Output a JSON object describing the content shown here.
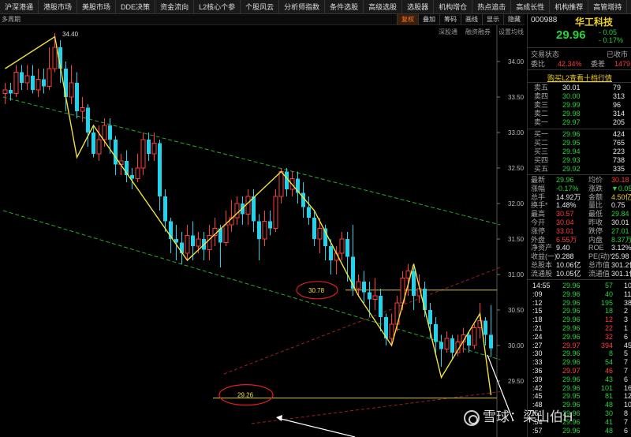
{
  "menu": [
    "沪深港通",
    "港股市场",
    "美股市场",
    "DDE决策",
    "资金流向",
    "L2核心个参",
    "个股风云",
    "分析师指数",
    "条件选股",
    "高级选股",
    "选股器",
    "机构增仓",
    "热点追击",
    "高成长性",
    "机构推荐",
    "高管增持"
  ],
  "toolbar": {
    "period_label": "多周期",
    "buttons": [
      "复权",
      "叠加",
      "筹码",
      "画线",
      "显示",
      "隐藏"
    ],
    "active_button": "复权"
  },
  "sublinks": [
    "深股通",
    "融资融券",
    "设置均线"
  ],
  "stock": {
    "code": "000988",
    "name": "华工科技",
    "price": "29.96",
    "change": "- 0.05",
    "change_pct": "- 0.17%"
  },
  "status": {
    "label": "交易状态",
    "value": "已收市",
    "wb_label": "委比",
    "wb_value": "42.34%",
    "wc_label": "委差",
    "wc_value": "1479"
  },
  "l2_link": "购买L2查看十档行情",
  "asks": [
    {
      "label": "卖五",
      "price": "30.01",
      "vol": "79"
    },
    {
      "label": "卖四",
      "price": "30.00",
      "vol": "313"
    },
    {
      "label": "卖三",
      "price": "29.99",
      "vol": "96"
    },
    {
      "label": "卖二",
      "price": "29.98",
      "vol": "314"
    },
    {
      "label": "卖一",
      "price": "29.97",
      "vol": "205"
    }
  ],
  "bids": [
    {
      "label": "买一",
      "price": "29.96",
      "vol": "424"
    },
    {
      "label": "买二",
      "price": "29.95",
      "vol": "765"
    },
    {
      "label": "买三",
      "price": "29.94",
      "vol": "223"
    },
    {
      "label": "买四",
      "price": "29.93",
      "vol": "738"
    },
    {
      "label": "买五",
      "price": "29.92",
      "vol": "335"
    }
  ],
  "stats": [
    {
      "l1": "最新",
      "v1": "29.96",
      "c1": "grn",
      "l2": "均价",
      "v2": "30.18",
      "c2": "red"
    },
    {
      "l1": "涨幅",
      "v1": "-0.17%",
      "c1": "grn",
      "l2": "涨跌",
      "v2": "▼0.05",
      "c2": "grn"
    },
    {
      "l1": "总手",
      "v1": "14.92万",
      "c1": "wht",
      "l2": "金额",
      "v2": "4.50亿",
      "c2": "yel"
    },
    {
      "l1": "换手*",
      "v1": "1.48%",
      "c1": "wht",
      "l2": "量比",
      "v2": "0.75",
      "c2": "wht"
    },
    {
      "l1": "最高",
      "v1": "30.57",
      "c1": "red",
      "l2": "最低",
      "v2": "29.84",
      "c2": "grn"
    },
    {
      "l1": "今开",
      "v1": "30.04",
      "c1": "red",
      "l2": "昨收",
      "v2": "30.01",
      "c2": "wht"
    },
    {
      "l1": "涨停",
      "v1": "33.01",
      "c1": "red",
      "l2": "跌停",
      "v2": "27.01",
      "c2": "grn"
    },
    {
      "l1": "外盘",
      "v1": "6.55万",
      "c1": "red",
      "l2": "内盘",
      "v2": "8.37万",
      "c2": "grn"
    },
    {
      "l1": "净资产",
      "v1": "9.40",
      "c1": "wht",
      "l2": "ROE",
      "v2": "3.12%",
      "c2": "wht"
    },
    {
      "l1": "收益(一)",
      "v1": "0.288",
      "c1": "wht",
      "l2": "PE(动)*",
      "v2": "25.98",
      "c2": "wht"
    },
    {
      "l1": "总股本",
      "v1": "10.06亿",
      "c1": "wht",
      "l2": "总市值",
      "v2": "301.2亿",
      "c2": "wht"
    },
    {
      "l1": "流通股",
      "v1": "10.05亿",
      "c1": "wht",
      "l2": "流通值",
      "v2": "301.1亿",
      "c2": "wht"
    }
  ],
  "ticks": [
    {
      "t": "14:55",
      "p": "29.96",
      "pc": "grn",
      "v": "57",
      "vc": "grn",
      "x": "10"
    },
    {
      "t": ":09",
      "p": "29.96",
      "pc": "grn",
      "v": "40",
      "vc": "grn",
      "x": "11"
    },
    {
      "t": ":12",
      "p": "29.96",
      "pc": "grn",
      "v": "195",
      "vc": "grn",
      "x": "38"
    },
    {
      "t": ":15",
      "p": "29.96",
      "pc": "grn",
      "v": "18",
      "vc": "grn",
      "x": "2"
    },
    {
      "t": ":18",
      "p": "29.96",
      "pc": "grn",
      "v": "12",
      "vc": "red",
      "x": "3"
    },
    {
      "t": ":21",
      "p": "29.96",
      "pc": "grn",
      "v": "22",
      "vc": "red",
      "x": "1"
    },
    {
      "t": ":24",
      "p": "29.96",
      "pc": "grn",
      "v": "32",
      "vc": "red",
      "x": "6"
    },
    {
      "t": ":27",
      "p": "29.97",
      "pc": "red",
      "v": "394",
      "vc": "red",
      "x": "45"
    },
    {
      "t": ":30",
      "p": "29.96",
      "pc": "grn",
      "v": "8",
      "vc": "grn",
      "x": "5"
    },
    {
      "t": ":33",
      "p": "29.96",
      "pc": "grn",
      "v": "54",
      "vc": "grn",
      "x": "7"
    },
    {
      "t": ":36",
      "p": "29.97",
      "pc": "red",
      "v": "46",
      "vc": "red",
      "x": "7"
    },
    {
      "t": ":39",
      "p": "29.96",
      "pc": "grn",
      "v": "43",
      "vc": "grn",
      "x": "6"
    },
    {
      "t": ":42",
      "p": "29.96",
      "pc": "grn",
      "v": "101",
      "vc": "grn",
      "x": "16"
    },
    {
      "t": ":45",
      "p": "29.95",
      "pc": "grn",
      "v": "81",
      "vc": "grn",
      "x": "12"
    },
    {
      "t": ":48",
      "p": "29.96",
      "pc": "grn",
      "v": "48",
      "vc": "grn",
      "x": "10"
    },
    {
      "t": ":51",
      "p": "29.96",
      "pc": "grn",
      "v": "30",
      "vc": "grn",
      "x": "8"
    },
    {
      "t": ":54",
      "p": "29.96",
      "pc": "grn",
      "v": "41",
      "vc": "grn",
      "x": "7"
    },
    {
      "t": ":57",
      "p": "29.96",
      "pc": "grn",
      "v": "48",
      "vc": "grn",
      "x": "6"
    }
  ],
  "watermark": "雪球：梁山伯H",
  "chart_data": {
    "type": "candlestick",
    "title": "",
    "xlabel": "",
    "ylabel": "",
    "ylim": [
      29.4,
      34.4
    ],
    "yticks": [
      "34.00",
      "33.50",
      "33.00",
      "32.50",
      "32.00",
      "31.50",
      "31.00",
      "30.50",
      "30.00",
      "29.50"
    ],
    "high_label": "34.40",
    "annotations": [
      "30.78",
      "29.26"
    ],
    "colors": {
      "up": "#ff3b3b",
      "down": "#21d4ee",
      "zigzag": "#f0e040",
      "channel": "#2ea82e",
      "trend": "#a02020"
    },
    "candles": [
      [
        33.55,
        33.6,
        33.4,
        33.7
      ],
      [
        33.6,
        33.55,
        33.45,
        33.7
      ],
      [
        33.55,
        33.85,
        33.5,
        33.95
      ],
      [
        33.85,
        33.7,
        33.6,
        33.95
      ],
      [
        33.7,
        33.8,
        33.6,
        33.95
      ],
      [
        33.8,
        33.6,
        33.55,
        33.95
      ],
      [
        33.6,
        33.75,
        33.5,
        33.9
      ],
      [
        33.75,
        33.65,
        33.55,
        33.9
      ],
      [
        33.65,
        33.9,
        33.6,
        34.2
      ],
      [
        33.9,
        34.2,
        33.85,
        34.4
      ],
      [
        34.2,
        33.9,
        33.7,
        34.3
      ],
      [
        33.9,
        33.5,
        33.3,
        34.0
      ],
      [
        33.5,
        33.7,
        33.4,
        33.95
      ],
      [
        33.7,
        33.3,
        33.2,
        33.85
      ],
      [
        33.3,
        33.35,
        33.15,
        33.5
      ],
      [
        33.35,
        33.0,
        32.8,
        33.4
      ],
      [
        33.0,
        32.7,
        32.65,
        33.1
      ],
      [
        32.7,
        32.9,
        32.6,
        33.1
      ],
      [
        32.9,
        33.1,
        32.8,
        33.2
      ],
      [
        33.1,
        32.9,
        32.7,
        33.2
      ],
      [
        32.9,
        32.55,
        32.4,
        32.95
      ],
      [
        32.55,
        32.6,
        32.4,
        32.7
      ],
      [
        32.6,
        32.4,
        32.3,
        32.75
      ],
      [
        32.4,
        32.35,
        32.2,
        32.5
      ],
      [
        32.35,
        32.5,
        32.3,
        32.7
      ],
      [
        32.5,
        32.9,
        32.4,
        33.0
      ],
      [
        32.9,
        32.7,
        32.6,
        33.0
      ],
      [
        32.7,
        32.85,
        32.6,
        33.0
      ],
      [
        32.85,
        32.1,
        31.9,
        32.9
      ],
      [
        32.1,
        31.75,
        31.6,
        32.2
      ],
      [
        31.75,
        31.5,
        31.3,
        31.8
      ],
      [
        31.5,
        31.45,
        31.2,
        31.7
      ],
      [
        31.45,
        31.3,
        31.15,
        31.6
      ],
      [
        31.3,
        31.55,
        31.2,
        31.7
      ],
      [
        31.55,
        31.4,
        31.2,
        31.75
      ],
      [
        31.4,
        31.5,
        31.3,
        31.6
      ],
      [
        31.5,
        31.35,
        31.2,
        31.6
      ],
      [
        31.35,
        31.55,
        31.2,
        31.7
      ],
      [
        31.55,
        31.65,
        31.4,
        31.8
      ],
      [
        31.65,
        31.45,
        31.1,
        31.7
      ],
      [
        31.45,
        31.7,
        31.4,
        31.9
      ],
      [
        31.7,
        31.8,
        31.6,
        32.05
      ],
      [
        31.8,
        32.0,
        31.7,
        32.1
      ],
      [
        32.0,
        31.85,
        31.7,
        32.1
      ],
      [
        31.85,
        32.1,
        31.7,
        32.2
      ],
      [
        32.1,
        31.75,
        31.6,
        32.2
      ],
      [
        31.75,
        31.5,
        31.2,
        31.85
      ],
      [
        31.5,
        31.75,
        31.4,
        31.9
      ],
      [
        31.75,
        31.65,
        31.55,
        31.9
      ],
      [
        31.65,
        32.1,
        31.6,
        32.2
      ],
      [
        32.1,
        32.45,
        32.0,
        32.5
      ],
      [
        32.45,
        32.2,
        32.1,
        32.5
      ],
      [
        32.2,
        32.35,
        32.1,
        32.45
      ],
      [
        32.35,
        32.15,
        32.0,
        32.45
      ],
      [
        32.15,
        31.95,
        31.8,
        32.3
      ],
      [
        31.95,
        31.8,
        31.7,
        32.1
      ],
      [
        31.8,
        31.5,
        31.4,
        31.9
      ],
      [
        31.5,
        31.65,
        31.3,
        31.8
      ],
      [
        31.65,
        31.4,
        31.2,
        31.7
      ],
      [
        31.4,
        31.2,
        31.0,
        31.5
      ],
      [
        31.2,
        31.3,
        31.0,
        31.4
      ],
      [
        31.3,
        31.5,
        31.2,
        31.6
      ],
      [
        31.5,
        31.25,
        30.9,
        31.6
      ],
      [
        31.25,
        30.8,
        30.7,
        31.7
      ],
      [
        30.8,
        30.9,
        30.7,
        31.0
      ],
      [
        30.9,
        30.75,
        30.6,
        31.05
      ],
      [
        30.75,
        30.65,
        30.4,
        30.9
      ],
      [
        30.65,
        30.7,
        30.5,
        30.95
      ],
      [
        30.7,
        30.4,
        30.2,
        30.8
      ],
      [
        30.4,
        30.1,
        30.0,
        30.45
      ],
      [
        30.1,
        30.3,
        30.0,
        30.45
      ],
      [
        30.3,
        30.6,
        30.2,
        30.7
      ],
      [
        30.6,
        30.95,
        30.5,
        31.05
      ],
      [
        30.95,
        31.05,
        30.7,
        31.15
      ],
      [
        31.05,
        30.7,
        30.5,
        31.1
      ],
      [
        30.7,
        30.8,
        30.6,
        31.0
      ],
      [
        30.8,
        30.5,
        30.4,
        30.9
      ],
      [
        30.5,
        30.3,
        30.1,
        30.6
      ],
      [
        30.3,
        30.05,
        29.85,
        30.4
      ],
      [
        30.05,
        29.95,
        29.7,
        30.15
      ],
      [
        29.95,
        30.1,
        29.9,
        30.2
      ],
      [
        30.1,
        29.9,
        29.8,
        30.15
      ],
      [
        29.9,
        30.05,
        29.85,
        30.15
      ],
      [
        30.05,
        30.15,
        29.9,
        30.25
      ],
      [
        30.15,
        30.0,
        29.9,
        30.2
      ],
      [
        30.0,
        30.25,
        29.95,
        30.3
      ],
      [
        30.25,
        30.35,
        30.1,
        30.6
      ],
      [
        30.35,
        30.15,
        30.0,
        30.4
      ],
      [
        30.15,
        29.96,
        29.84,
        30.57
      ]
    ],
    "zigzag": [
      [
        0,
        33.9
      ],
      [
        9,
        34.35
      ],
      [
        13,
        32.65
      ],
      [
        16,
        33.1
      ],
      [
        33,
        31.2
      ],
      [
        50,
        32.45
      ],
      [
        56,
        31.9
      ],
      [
        64,
        30.7
      ],
      [
        70,
        30.0
      ],
      [
        74,
        31.15
      ],
      [
        79,
        29.55
      ],
      [
        86,
        30.45
      ],
      [
        88,
        29.3
      ]
    ],
    "horizontal_levels": [
      30.78,
      29.26
    ]
  }
}
